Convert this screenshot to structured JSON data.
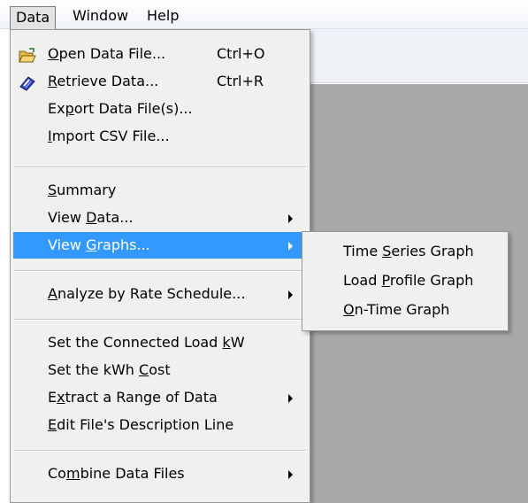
{
  "menubar": {
    "items": [
      {
        "label": "Data"
      },
      {
        "label": "Window"
      },
      {
        "label": "Help"
      }
    ]
  },
  "data_menu": {
    "groups": [
      [
        {
          "label": "Open Data File...",
          "shortcut": "Ctrl+O",
          "icon": "open-folder-icon"
        },
        {
          "label": "Retrieve Data...",
          "shortcut": "Ctrl+R",
          "icon": "retrieve-data-icon"
        },
        {
          "label": "Export Data File(s)..."
        },
        {
          "label": "Import CSV File..."
        }
      ],
      [
        {
          "label": "Summary"
        },
        {
          "label": "View Data...",
          "submenu": true
        },
        {
          "label": "View Graphs...",
          "submenu": true,
          "highlighted": true
        }
      ],
      [
        {
          "label": "Analyze by Rate Schedule...",
          "submenu": true
        }
      ],
      [
        {
          "label": "Set the Connected Load kW"
        },
        {
          "label": "Set the kWh Cost"
        },
        {
          "label": "Extract a Range of Data",
          "submenu": true
        },
        {
          "label": "Edit File's Description Line"
        }
      ],
      [
        {
          "label": "Combine Data Files",
          "submenu": true
        }
      ]
    ]
  },
  "view_graphs_submenu": {
    "items": [
      {
        "label": "Time Series Graph"
      },
      {
        "label": "Load Profile Graph"
      },
      {
        "label": "On-Time Graph"
      }
    ]
  },
  "colors": {
    "highlight": "#3399ff",
    "menu_background": "#f0f0f0",
    "workspace": "#a9a9a9"
  }
}
